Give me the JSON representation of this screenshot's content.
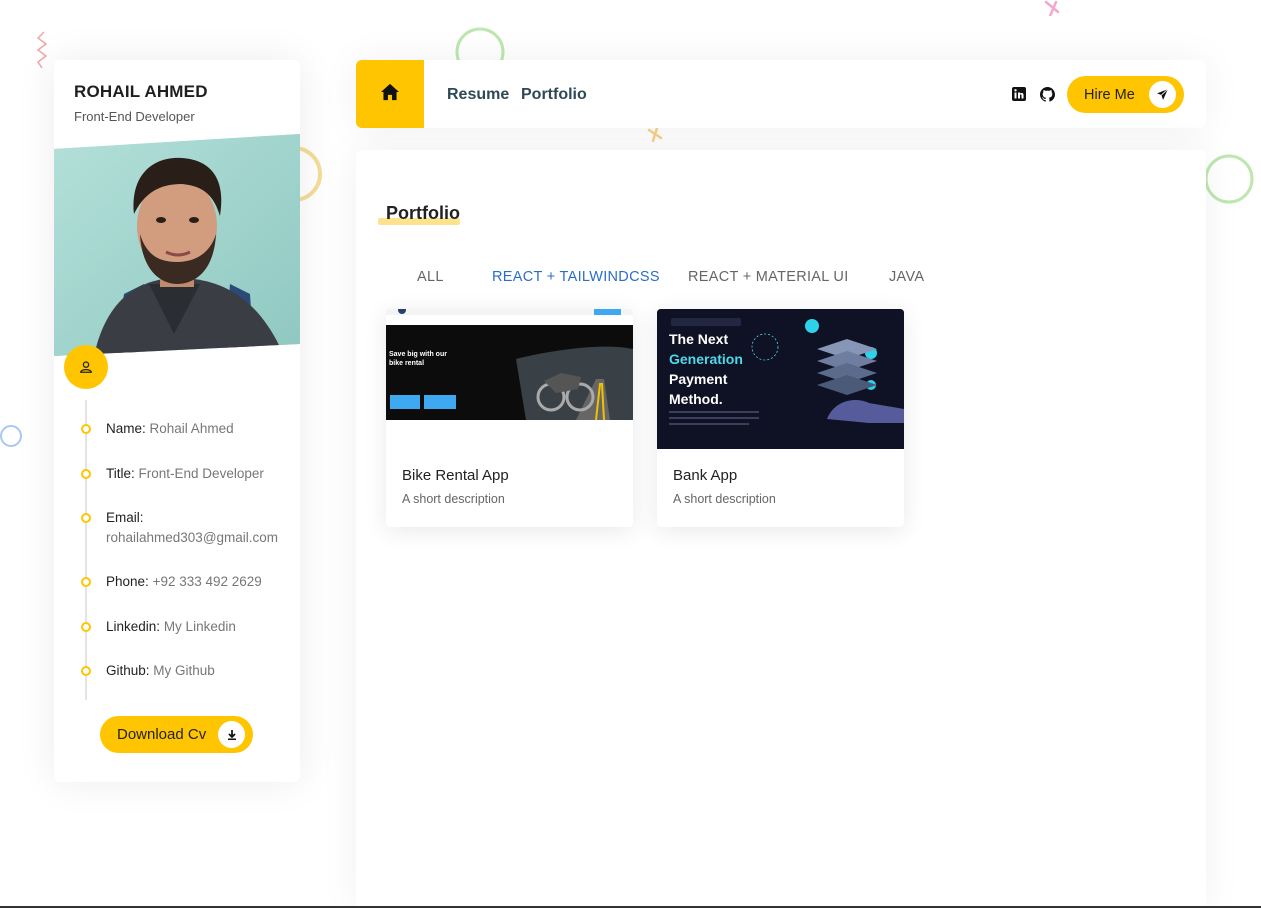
{
  "profile": {
    "name": "ROHAIL AHMED",
    "role": "Front-End Developer"
  },
  "info": [
    {
      "label": "Name:",
      "value": "Rohail Ahmed"
    },
    {
      "label": "Title:",
      "value": "Front-End Developer"
    },
    {
      "label": "Email:",
      "value": "rohailahmed303@gmail.com"
    },
    {
      "label": "Phone:",
      "value": "+92 333 492 2629"
    },
    {
      "label": "Linkedin:",
      "value": "My Linkedin"
    },
    {
      "label": "Github:",
      "value": "My Github"
    }
  ],
  "download_label": "Download Cv",
  "nav": {
    "links": [
      "Resume",
      "Portfolio"
    ],
    "hire_label": "Hire Me",
    "icons": [
      "home-icon",
      "linkedin-icon",
      "github-icon",
      "send-icon"
    ]
  },
  "portfolio": {
    "title": "Portfolio",
    "filters": [
      "ALL",
      "REACT + TAILWINDCSS",
      "REACT + MATERIAL UI",
      "JAVA"
    ],
    "active_filter": "REACT + TAILWINDCSS",
    "projects": [
      {
        "title": "Bike Rental App",
        "description": "A short description",
        "thumb_headline": "Save big with our bike rental"
      },
      {
        "title": "Bank App",
        "description": "A short description",
        "thumb_headline_1": "The Next",
        "thumb_headline_2": "Generation",
        "thumb_headline_3": "Payment",
        "thumb_headline_4": "Method."
      }
    ]
  },
  "colors": {
    "accent": "#ffc500",
    "active_filter": "#2b6ec7",
    "nav_text": "#2f4858"
  }
}
